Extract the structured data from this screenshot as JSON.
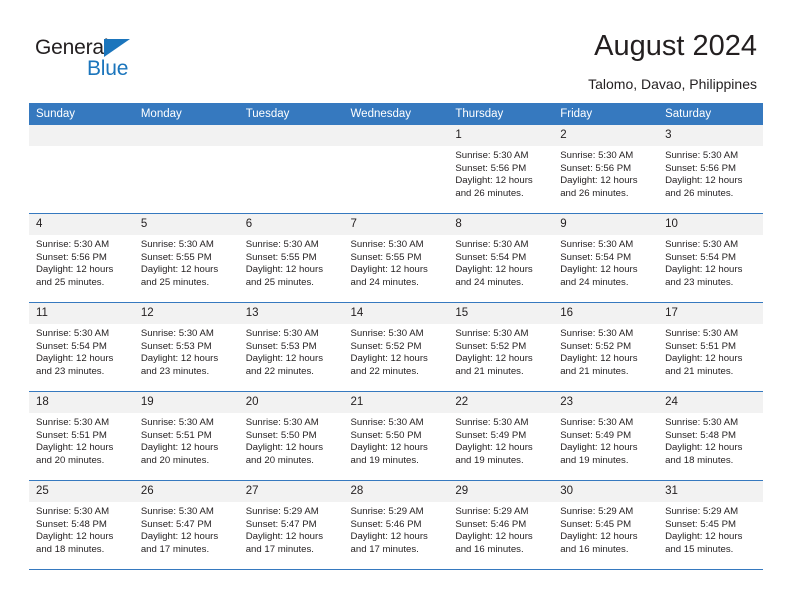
{
  "brand": {
    "name_part1": "General",
    "name_part2": "Blue",
    "triangle_color": "#1b75bc"
  },
  "header": {
    "title": "August 2024",
    "subtitle": "Talomo, Davao, Philippines"
  },
  "theme": {
    "header_bg": "#3679bf",
    "daynum_bg": "#f2f2f2",
    "text": "#231f20"
  },
  "calendar": {
    "weekday_headers": [
      "Sunday",
      "Monday",
      "Tuesday",
      "Wednesday",
      "Thursday",
      "Friday",
      "Saturday"
    ],
    "weeks": [
      [
        {
          "day": "",
          "sunrise": "",
          "sunset": "",
          "daylight_line1": "",
          "daylight_line2": "",
          "empty": true
        },
        {
          "day": "",
          "sunrise": "",
          "sunset": "",
          "daylight_line1": "",
          "daylight_line2": "",
          "empty": true
        },
        {
          "day": "",
          "sunrise": "",
          "sunset": "",
          "daylight_line1": "",
          "daylight_line2": "",
          "empty": true
        },
        {
          "day": "",
          "sunrise": "",
          "sunset": "",
          "daylight_line1": "",
          "daylight_line2": "",
          "empty": true
        },
        {
          "day": "1",
          "sunrise": "Sunrise: 5:30 AM",
          "sunset": "Sunset: 5:56 PM",
          "daylight_line1": "Daylight: 12 hours",
          "daylight_line2": "and 26 minutes."
        },
        {
          "day": "2",
          "sunrise": "Sunrise: 5:30 AM",
          "sunset": "Sunset: 5:56 PM",
          "daylight_line1": "Daylight: 12 hours",
          "daylight_line2": "and 26 minutes."
        },
        {
          "day": "3",
          "sunrise": "Sunrise: 5:30 AM",
          "sunset": "Sunset: 5:56 PM",
          "daylight_line1": "Daylight: 12 hours",
          "daylight_line2": "and 26 minutes."
        }
      ],
      [
        {
          "day": "4",
          "sunrise": "Sunrise: 5:30 AM",
          "sunset": "Sunset: 5:56 PM",
          "daylight_line1": "Daylight: 12 hours",
          "daylight_line2": "and 25 minutes."
        },
        {
          "day": "5",
          "sunrise": "Sunrise: 5:30 AM",
          "sunset": "Sunset: 5:55 PM",
          "daylight_line1": "Daylight: 12 hours",
          "daylight_line2": "and 25 minutes."
        },
        {
          "day": "6",
          "sunrise": "Sunrise: 5:30 AM",
          "sunset": "Sunset: 5:55 PM",
          "daylight_line1": "Daylight: 12 hours",
          "daylight_line2": "and 25 minutes."
        },
        {
          "day": "7",
          "sunrise": "Sunrise: 5:30 AM",
          "sunset": "Sunset: 5:55 PM",
          "daylight_line1": "Daylight: 12 hours",
          "daylight_line2": "and 24 minutes."
        },
        {
          "day": "8",
          "sunrise": "Sunrise: 5:30 AM",
          "sunset": "Sunset: 5:54 PM",
          "daylight_line1": "Daylight: 12 hours",
          "daylight_line2": "and 24 minutes."
        },
        {
          "day": "9",
          "sunrise": "Sunrise: 5:30 AM",
          "sunset": "Sunset: 5:54 PM",
          "daylight_line1": "Daylight: 12 hours",
          "daylight_line2": "and 24 minutes."
        },
        {
          "day": "10",
          "sunrise": "Sunrise: 5:30 AM",
          "sunset": "Sunset: 5:54 PM",
          "daylight_line1": "Daylight: 12 hours",
          "daylight_line2": "and 23 minutes."
        }
      ],
      [
        {
          "day": "11",
          "sunrise": "Sunrise: 5:30 AM",
          "sunset": "Sunset: 5:54 PM",
          "daylight_line1": "Daylight: 12 hours",
          "daylight_line2": "and 23 minutes."
        },
        {
          "day": "12",
          "sunrise": "Sunrise: 5:30 AM",
          "sunset": "Sunset: 5:53 PM",
          "daylight_line1": "Daylight: 12 hours",
          "daylight_line2": "and 23 minutes."
        },
        {
          "day": "13",
          "sunrise": "Sunrise: 5:30 AM",
          "sunset": "Sunset: 5:53 PM",
          "daylight_line1": "Daylight: 12 hours",
          "daylight_line2": "and 22 minutes."
        },
        {
          "day": "14",
          "sunrise": "Sunrise: 5:30 AM",
          "sunset": "Sunset: 5:52 PM",
          "daylight_line1": "Daylight: 12 hours",
          "daylight_line2": "and 22 minutes."
        },
        {
          "day": "15",
          "sunrise": "Sunrise: 5:30 AM",
          "sunset": "Sunset: 5:52 PM",
          "daylight_line1": "Daylight: 12 hours",
          "daylight_line2": "and 21 minutes."
        },
        {
          "day": "16",
          "sunrise": "Sunrise: 5:30 AM",
          "sunset": "Sunset: 5:52 PM",
          "daylight_line1": "Daylight: 12 hours",
          "daylight_line2": "and 21 minutes."
        },
        {
          "day": "17",
          "sunrise": "Sunrise: 5:30 AM",
          "sunset": "Sunset: 5:51 PM",
          "daylight_line1": "Daylight: 12 hours",
          "daylight_line2": "and 21 minutes."
        }
      ],
      [
        {
          "day": "18",
          "sunrise": "Sunrise: 5:30 AM",
          "sunset": "Sunset: 5:51 PM",
          "daylight_line1": "Daylight: 12 hours",
          "daylight_line2": "and 20 minutes."
        },
        {
          "day": "19",
          "sunrise": "Sunrise: 5:30 AM",
          "sunset": "Sunset: 5:51 PM",
          "daylight_line1": "Daylight: 12 hours",
          "daylight_line2": "and 20 minutes."
        },
        {
          "day": "20",
          "sunrise": "Sunrise: 5:30 AM",
          "sunset": "Sunset: 5:50 PM",
          "daylight_line1": "Daylight: 12 hours",
          "daylight_line2": "and 20 minutes."
        },
        {
          "day": "21",
          "sunrise": "Sunrise: 5:30 AM",
          "sunset": "Sunset: 5:50 PM",
          "daylight_line1": "Daylight: 12 hours",
          "daylight_line2": "and 19 minutes."
        },
        {
          "day": "22",
          "sunrise": "Sunrise: 5:30 AM",
          "sunset": "Sunset: 5:49 PM",
          "daylight_line1": "Daylight: 12 hours",
          "daylight_line2": "and 19 minutes."
        },
        {
          "day": "23",
          "sunrise": "Sunrise: 5:30 AM",
          "sunset": "Sunset: 5:49 PM",
          "daylight_line1": "Daylight: 12 hours",
          "daylight_line2": "and 19 minutes."
        },
        {
          "day": "24",
          "sunrise": "Sunrise: 5:30 AM",
          "sunset": "Sunset: 5:48 PM",
          "daylight_line1": "Daylight: 12 hours",
          "daylight_line2": "and 18 minutes."
        }
      ],
      [
        {
          "day": "25",
          "sunrise": "Sunrise: 5:30 AM",
          "sunset": "Sunset: 5:48 PM",
          "daylight_line1": "Daylight: 12 hours",
          "daylight_line2": "and 18 minutes."
        },
        {
          "day": "26",
          "sunrise": "Sunrise: 5:30 AM",
          "sunset": "Sunset: 5:47 PM",
          "daylight_line1": "Daylight: 12 hours",
          "daylight_line2": "and 17 minutes."
        },
        {
          "day": "27",
          "sunrise": "Sunrise: 5:29 AM",
          "sunset": "Sunset: 5:47 PM",
          "daylight_line1": "Daylight: 12 hours",
          "daylight_line2": "and 17 minutes."
        },
        {
          "day": "28",
          "sunrise": "Sunrise: 5:29 AM",
          "sunset": "Sunset: 5:46 PM",
          "daylight_line1": "Daylight: 12 hours",
          "daylight_line2": "and 17 minutes."
        },
        {
          "day": "29",
          "sunrise": "Sunrise: 5:29 AM",
          "sunset": "Sunset: 5:46 PM",
          "daylight_line1": "Daylight: 12 hours",
          "daylight_line2": "and 16 minutes."
        },
        {
          "day": "30",
          "sunrise": "Sunrise: 5:29 AM",
          "sunset": "Sunset: 5:45 PM",
          "daylight_line1": "Daylight: 12 hours",
          "daylight_line2": "and 16 minutes."
        },
        {
          "day": "31",
          "sunrise": "Sunrise: 5:29 AM",
          "sunset": "Sunset: 5:45 PM",
          "daylight_line1": "Daylight: 12 hours",
          "daylight_line2": "and 15 minutes."
        }
      ]
    ]
  }
}
